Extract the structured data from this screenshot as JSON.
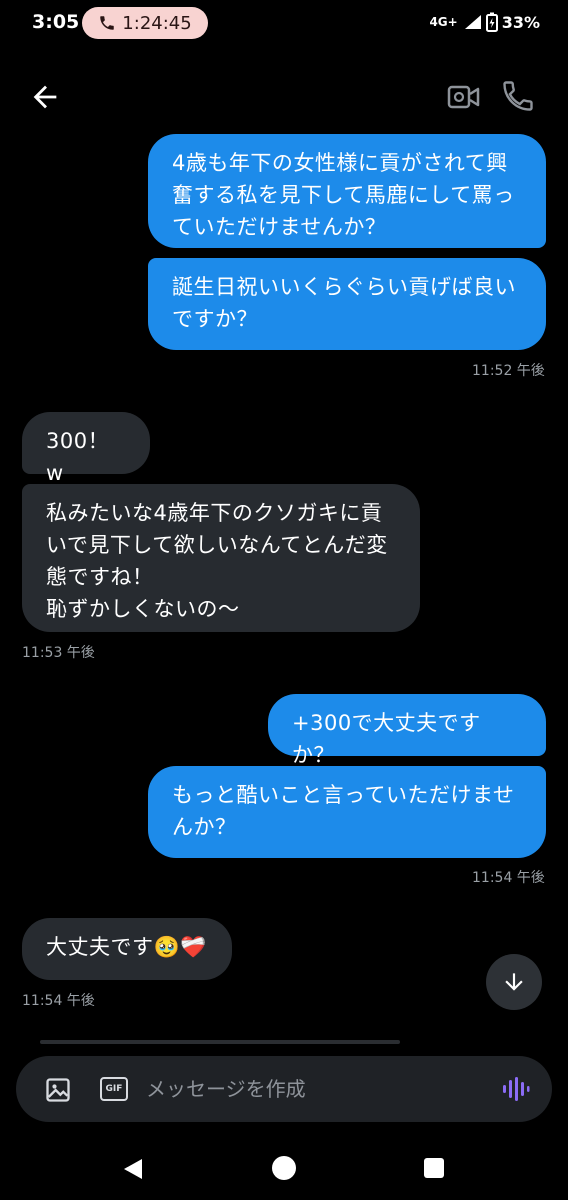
{
  "status_bar": {
    "time": "3:05",
    "call_timer": "1:24:45",
    "network": "4G+",
    "battery": "33%"
  },
  "header": {
    "back_icon": "arrow-left-icon",
    "video_icon": "video-camera-icon",
    "phone_icon": "phone-icon"
  },
  "messages": [
    {
      "direction": "out",
      "text": "4歳も年下の女性様に貢がされて興\n奮する私を見下して馬鹿にして罵っ\nていただけませんか？"
    },
    {
      "direction": "out",
      "text": "誕生日祝いいくらぐらい貢げば良い\nですか？"
    },
    {
      "direction": "in",
      "text": "300！w"
    },
    {
      "direction": "in",
      "text": "私みたいな4歳年下のクソガキに貢\nいで見下して欲しいなんてとんだ変\n態ですね！\n恥ずかしくないの〜"
    },
    {
      "direction": "out",
      "text": "+300で大丈夫ですか？"
    },
    {
      "direction": "out",
      "text": "もっと酷いこと言っていただけませ\nんか？"
    },
    {
      "direction": "in",
      "text": "大丈夫です🥹❤️‍🩹"
    }
  ],
  "timestamps": [
    "11:52 午後",
    "11:53 午後",
    "11:54 午後",
    "11:54 午後"
  ],
  "composer": {
    "placeholder": "メッセージを作成",
    "image_icon": "image-icon",
    "gif_label": "GIF",
    "voice_icon": "voice-wave-icon"
  },
  "colors": {
    "outgoing_bubble": "#1d8bea",
    "incoming_bubble": "#272b30",
    "call_pill": "#f8d3d1",
    "voice_accent": "#8b6cf6"
  }
}
